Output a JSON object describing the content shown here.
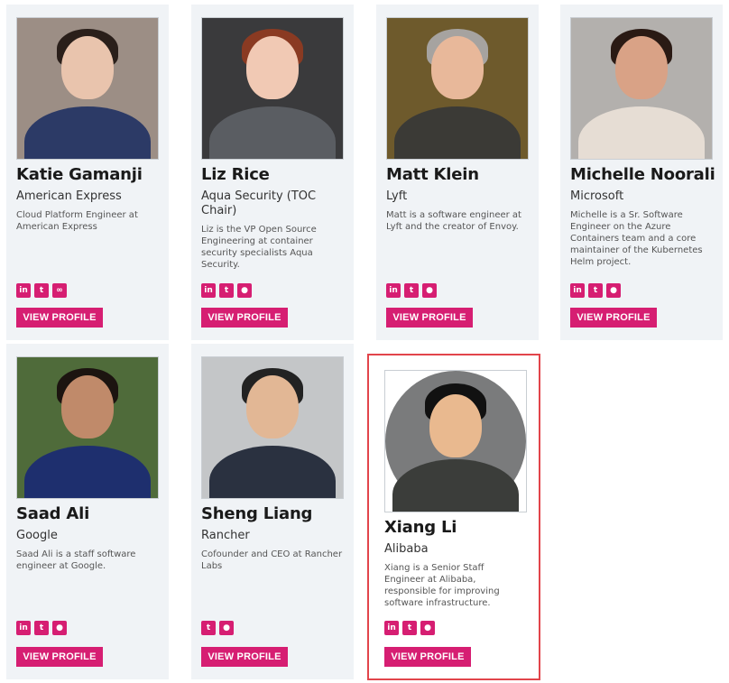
{
  "speakers": [
    {
      "name": "Katie Gamanji",
      "company": "American Express",
      "bio": "Cloud Platform Engineer at American Express",
      "socials": [
        "linkedin-icon",
        "twitter-icon",
        "link-icon"
      ],
      "button": "VIEW PROFILE"
    },
    {
      "name": "Liz Rice",
      "company": "Aqua Security (TOC Chair)",
      "bio": "Liz is the VP Open Source Engineering at container security specialists Aqua Security.",
      "socials": [
        "linkedin-icon",
        "twitter-icon",
        "github-icon"
      ],
      "button": "VIEW PROFILE"
    },
    {
      "name": "Matt Klein",
      "company": "Lyft",
      "bio": "Matt is a software engineer at Lyft and the creator of Envoy.",
      "socials": [
        "linkedin-icon",
        "twitter-icon",
        "github-icon"
      ],
      "button": "VIEW PROFILE"
    },
    {
      "name": "Michelle Noorali",
      "company": "Microsoft",
      "bio": "Michelle is a Sr. Software Engineer on the Azure Containers team and a core maintainer of the Kubernetes Helm project.",
      "socials": [
        "linkedin-icon",
        "twitter-icon",
        "github-icon"
      ],
      "button": "VIEW PROFILE"
    },
    {
      "name": "Saad Ali",
      "company": "Google",
      "bio": "Saad Ali is a staff software engineer at Google.",
      "socials": [
        "linkedin-icon",
        "twitter-icon",
        "github-icon"
      ],
      "button": "VIEW PROFILE"
    },
    {
      "name": "Sheng Liang",
      "company": "Rancher",
      "bio": "Cofounder and CEO at Rancher Labs",
      "socials": [
        "twitter-icon",
        "github-icon"
      ],
      "button": "VIEW PROFILE"
    },
    {
      "name": "Xiang Li",
      "company": "Alibaba",
      "bio": "Xiang is a Senior Staff Engineer at Alibaba, responsible for improving software infrastructure.",
      "socials": [
        "linkedin-icon",
        "twitter-icon",
        "github-icon"
      ],
      "button": "VIEW PROFILE"
    }
  ],
  "colors": {
    "accent": "#d61e72",
    "highlight": "#e2454b",
    "card": "#f0f3f6"
  }
}
